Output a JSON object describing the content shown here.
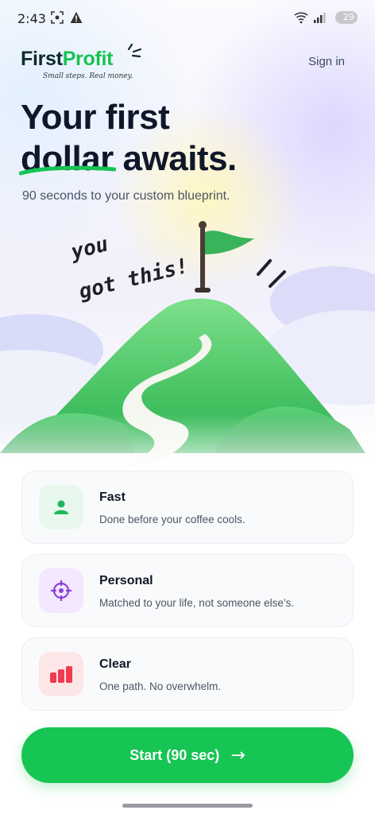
{
  "status_bar": {
    "time": "2:43",
    "battery": "29"
  },
  "header": {
    "logo_first": "First",
    "logo_profit": "Profit",
    "tagline": "Small steps. Real money.",
    "sign_in": "Sign in"
  },
  "hero": {
    "title_line1": "Your first",
    "title_line2_word": "dollar",
    "title_line2_rest": " awaits.",
    "subtitle": "90 seconds to your custom blueprint.",
    "handwritten_1": "you",
    "handwritten_2": "got this!"
  },
  "features": [
    {
      "title": "Fast",
      "desc": "Done before your coffee cools.",
      "icon": "person-icon",
      "color": "#1fb85a",
      "bg": "#e8f8ee"
    },
    {
      "title": "Personal",
      "desc": "Matched to your life, not someone else’s.",
      "icon": "target-icon",
      "color": "#8b3fd6",
      "bg": "#f3e8fd"
    },
    {
      "title": "Clear",
      "desc": "One path. No overwhelm.",
      "icon": "bar-chart-icon",
      "color": "#ef3b4f",
      "bg": "#fde6e8"
    }
  ],
  "cta": {
    "label": "Start (90 sec)",
    "arrow": "→"
  },
  "colors": {
    "brand_green": "#16c553",
    "heading": "#0f172a"
  }
}
